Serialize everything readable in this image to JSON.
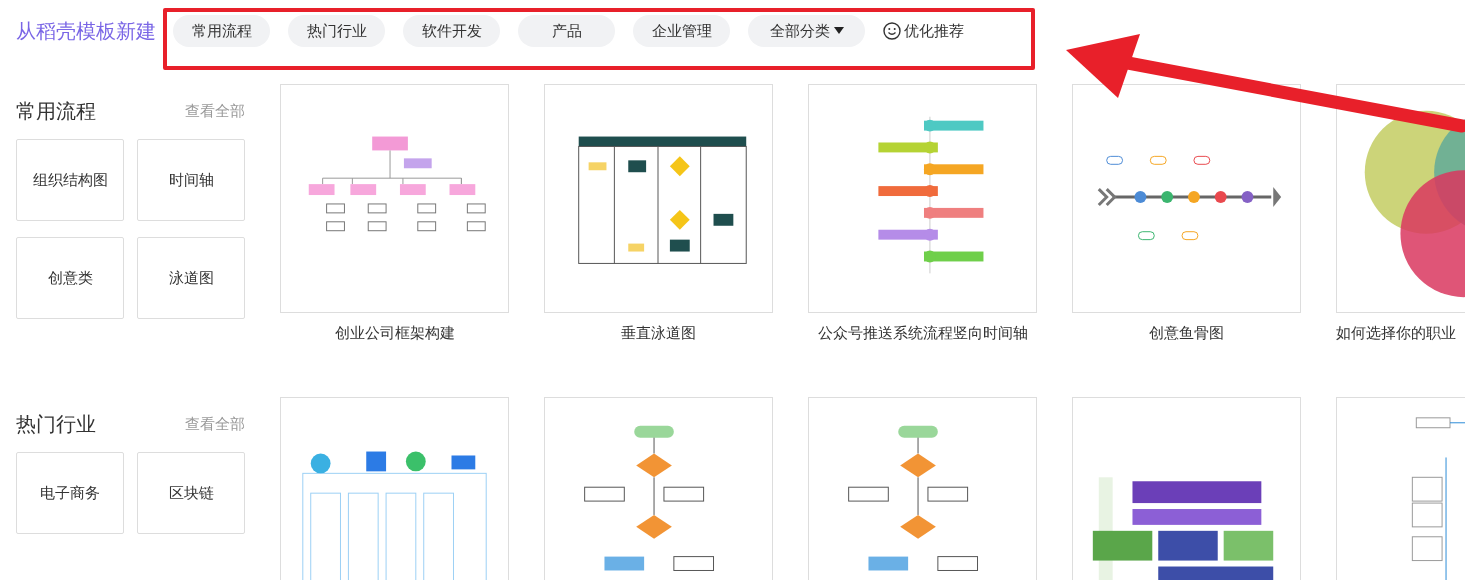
{
  "page_title": "从稻壳模板新建",
  "category_tabs": [
    {
      "label": "常用流程",
      "kind": "pill"
    },
    {
      "label": "热门行业",
      "kind": "pill"
    },
    {
      "label": "软件开发",
      "kind": "pill"
    },
    {
      "label": "产品",
      "kind": "pill"
    },
    {
      "label": "企业管理",
      "kind": "pill"
    },
    {
      "label": "全部分类",
      "kind": "dropdown"
    }
  ],
  "recommend": {
    "label": "优化推荐"
  },
  "sections": [
    {
      "title": "常用流程",
      "view_all": "查看全部",
      "categories": [
        "组织结构图",
        "时间轴",
        "创意类",
        "泳道图"
      ],
      "templates": [
        {
          "kind": "org-chart",
          "caption": "创业公司框架构建"
        },
        {
          "kind": "swimlane",
          "caption": "垂直泳道图"
        },
        {
          "kind": "timeline",
          "caption": "公众号推送系统流程竖向时间轴"
        },
        {
          "kind": "fishbone",
          "caption": "创意鱼骨图"
        },
        {
          "kind": "venn",
          "caption": "如何选择你的职业"
        }
      ]
    },
    {
      "title": "热门行业",
      "view_all": "查看全部",
      "categories": [
        "电子商务",
        "区块链"
      ],
      "templates": [
        {
          "kind": "architecture"
        },
        {
          "kind": "flowchart"
        },
        {
          "kind": "flowchart"
        },
        {
          "kind": "blocks"
        },
        {
          "kind": "mindmap"
        }
      ]
    }
  ]
}
